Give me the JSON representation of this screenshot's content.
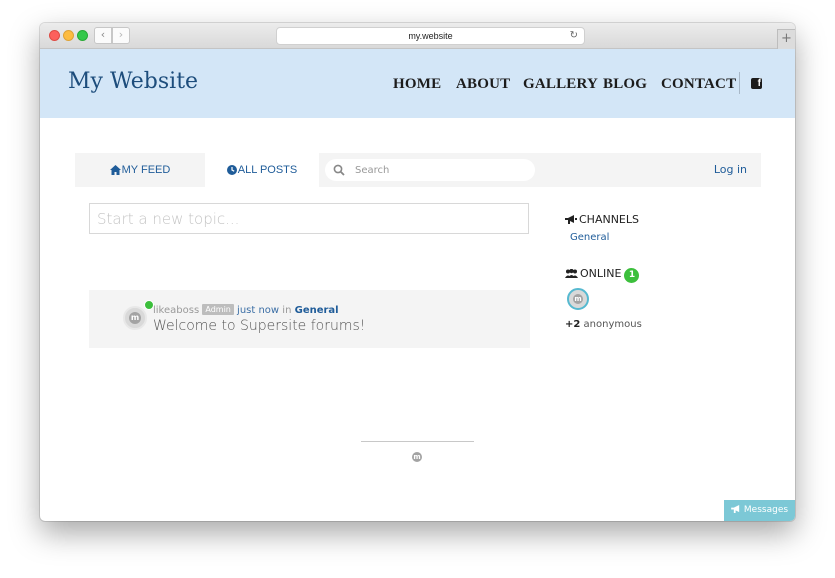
{
  "browser": {
    "url": "my.website",
    "back_glyph": "‹",
    "forward_glyph": "›",
    "reload_glyph": "↻",
    "newtab_glyph": "+"
  },
  "site": {
    "title": "My Website",
    "nav": [
      {
        "label": "HOME"
      },
      {
        "label": "ABOUT"
      },
      {
        "label": "GALLERY"
      },
      {
        "label": "BLOG"
      },
      {
        "label": "CONTACT"
      }
    ],
    "social_icon": "facebook-icon",
    "social_glyph": "f"
  },
  "forum": {
    "tabs": [
      {
        "label": "MY FEED",
        "icon": "home-icon"
      },
      {
        "label": "ALL POSTS",
        "icon": "clock-icon"
      }
    ],
    "search": {
      "placeholder": "Search",
      "value": ""
    },
    "login_label": "Log in",
    "new_topic_placeholder": "Start a new topic...",
    "topics": [
      {
        "author": "likeaboss",
        "role": "Admin",
        "time": "just now",
        "in_word": "in",
        "channel": "General",
        "title": "Welcome to Supersite forums!",
        "avatar_letter": "m"
      }
    ]
  },
  "sidebar": {
    "channels_heading": "CHANNELS",
    "channels": [
      "General"
    ],
    "online_heading": "ONLINE",
    "online_count": "1",
    "online_avatar_letter": "m",
    "anonymous_count": "+2",
    "anonymous_label": "anonymous"
  },
  "footer": {
    "logo_letter": "m"
  },
  "messages_label": "Messages",
  "colors": {
    "header_bg": "#d3e6f7",
    "logo": "#1d4d7c",
    "link": "#1f5c99",
    "online_green": "#3cbf3c",
    "messages_bg": "#7cc8d6"
  }
}
